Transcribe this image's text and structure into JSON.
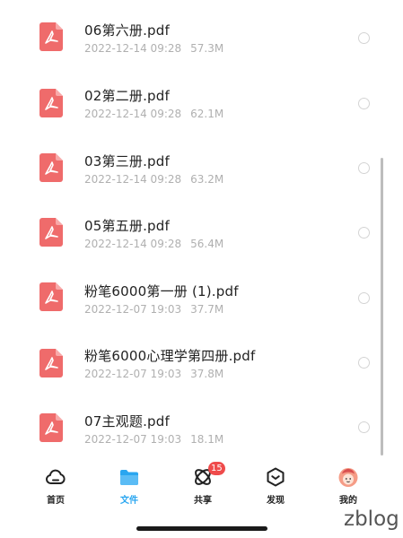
{
  "files": [
    {
      "name": "06第六册.pdf",
      "date": "2022-12-14 09:28",
      "size": "57.3M"
    },
    {
      "name": "02第二册.pdf",
      "date": "2022-12-14 09:28",
      "size": "62.1M"
    },
    {
      "name": "03第三册.pdf",
      "date": "2022-12-14 09:28",
      "size": "63.2M"
    },
    {
      "name": "05第五册.pdf",
      "date": "2022-12-14 09:28",
      "size": "56.4M"
    },
    {
      "name": "粉笔6000第一册 (1).pdf",
      "date": "2022-12-07 19:03",
      "size": "37.7M"
    },
    {
      "name": "粉笔6000心理学第四册.pdf",
      "date": "2022-12-07 19:03",
      "size": "37.8M"
    },
    {
      "name": "07主观题.pdf",
      "date": "2022-12-07 19:03",
      "size": "18.1M"
    }
  ],
  "tabs": [
    {
      "label": "首页",
      "icon": "home-cloud-icon"
    },
    {
      "label": "文件",
      "icon": "folder-icon",
      "active": true
    },
    {
      "label": "共享",
      "icon": "share-icon",
      "badge": "15"
    },
    {
      "label": "发现",
      "icon": "discover-icon"
    },
    {
      "label": "我的",
      "icon": "avatar-icon"
    }
  ],
  "watermark": "zblog",
  "colors": {
    "pdf_red": "#ef6b6b",
    "active_tab": "#2aa6f0",
    "badge": "#ef4b4b",
    "meta_text": "#b0b0b0"
  }
}
